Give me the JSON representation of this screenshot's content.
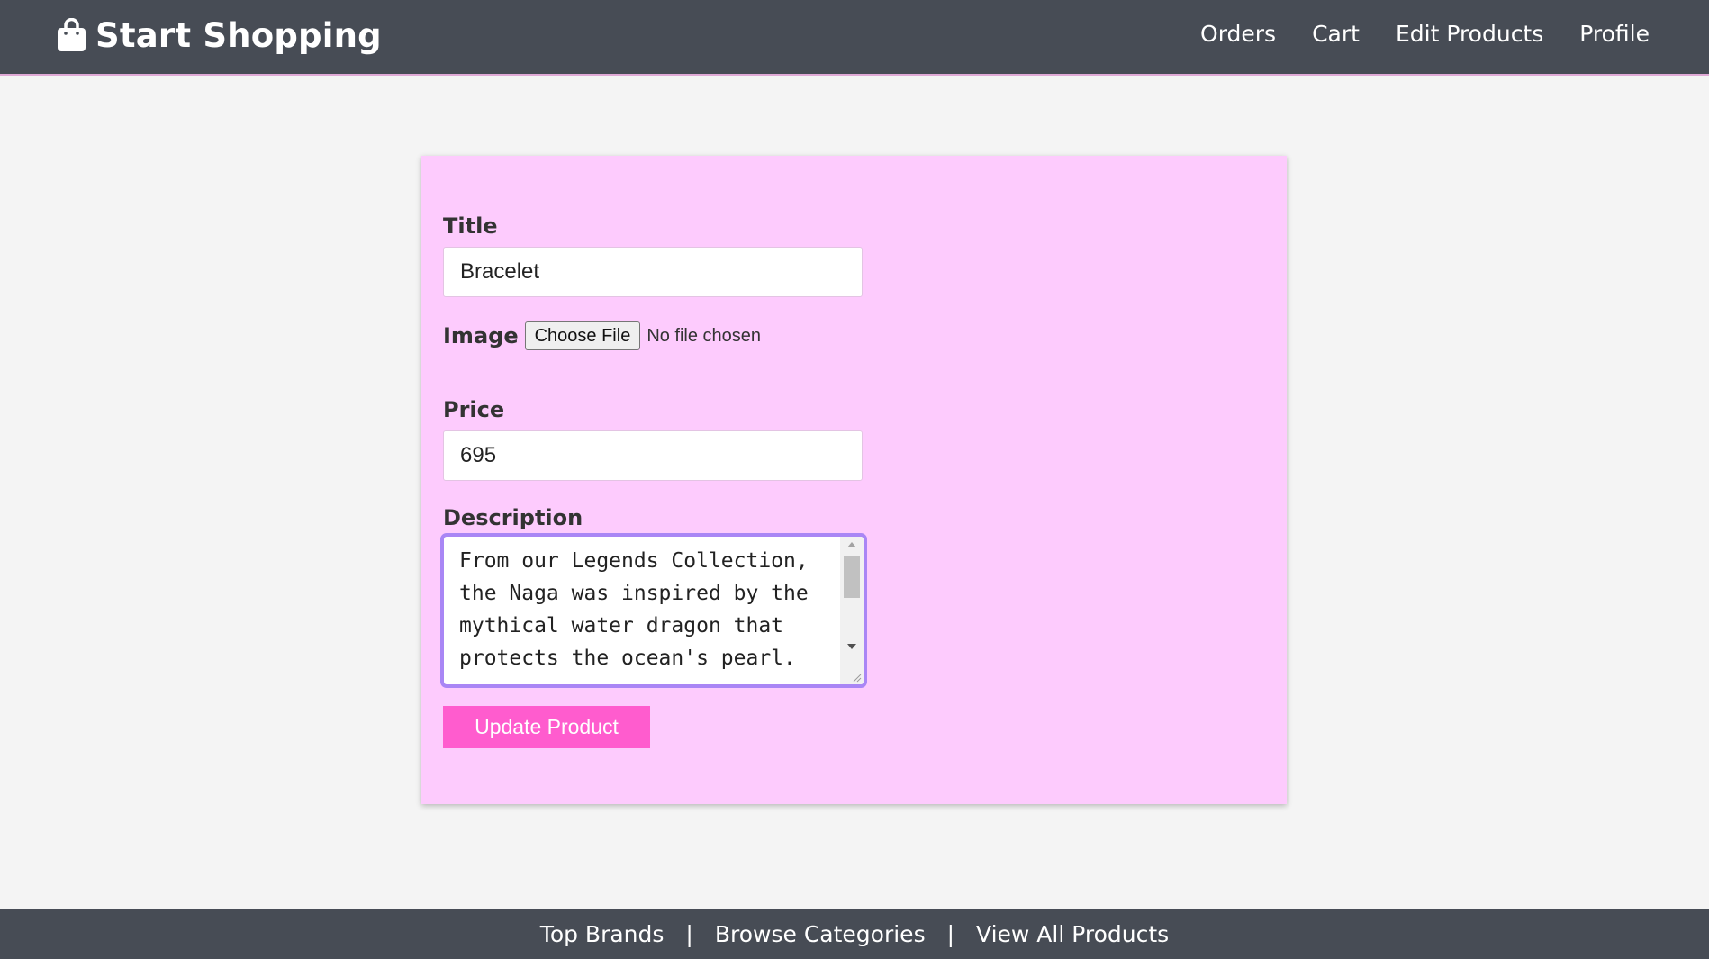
{
  "navbar": {
    "brand": "Start Shopping",
    "brand_icon": "shopping-bag-icon",
    "links": [
      "Orders",
      "Cart",
      "Edit Products",
      "Profile"
    ]
  },
  "form": {
    "title_label": "Title",
    "title_value": "Bracelet",
    "image_label": "Image",
    "file_button": "Choose File",
    "file_status": "No file chosen",
    "price_label": "Price",
    "price_value": "695",
    "description_label": "Description",
    "description_value": "From our Legends Collection,\nthe Naga was inspired by the\nmythical water dragon that\nprotects the ocean's pearl.",
    "submit_label": "Update Product"
  },
  "footer": {
    "links": [
      "Top Brands",
      "Browse Categories",
      "View All Products"
    ],
    "separator": "|"
  },
  "colors": {
    "navbar_bg": "#474c55",
    "card_bg": "#fdcbfd",
    "button_bg": "#ff5cce",
    "focus_border": "#a986f5"
  }
}
